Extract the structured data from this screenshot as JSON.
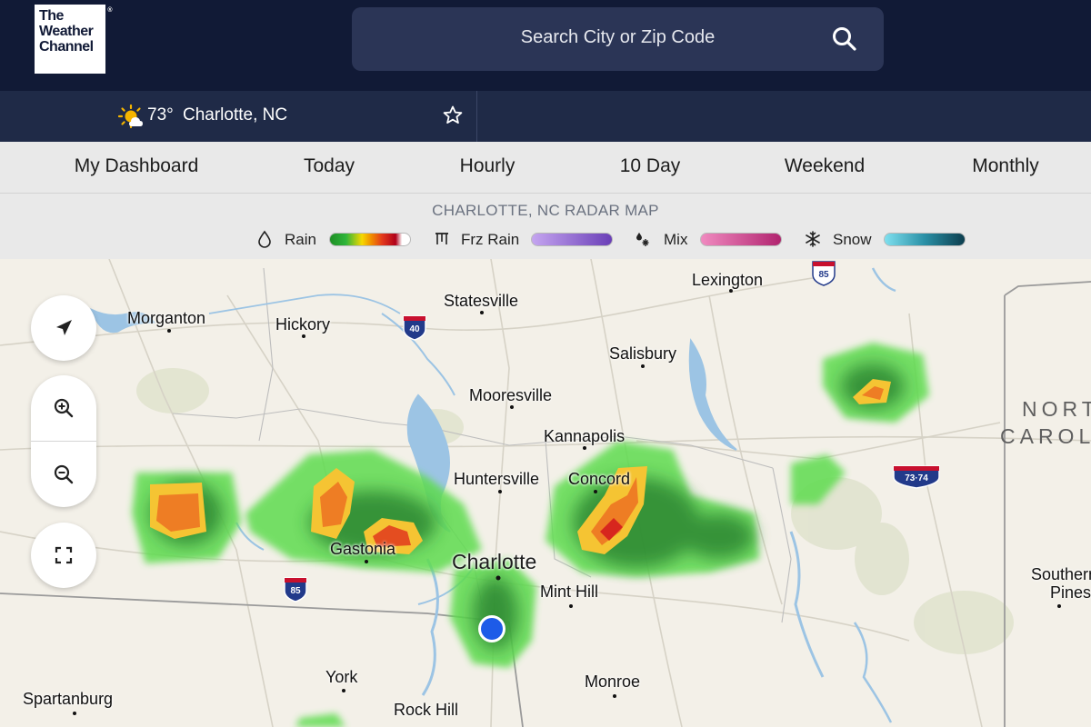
{
  "header": {
    "logo_lines": [
      "The",
      "Weather",
      "Channel"
    ],
    "logo_reg": "®",
    "search": {
      "placeholder": "Search City or Zip Code",
      "icon": "search-icon"
    }
  },
  "location": {
    "temp": "73°",
    "city": "Charlotte, NC",
    "weather_icon": "partly-cloudy-sun-icon",
    "favorite_icon": "star-icon"
  },
  "nav": {
    "items": [
      {
        "label": "My Dashboard"
      },
      {
        "label": "Today"
      },
      {
        "label": "Hourly"
      },
      {
        "label": "10 Day"
      },
      {
        "label": "Weekend"
      },
      {
        "label": "Monthly"
      }
    ]
  },
  "legend": {
    "title": "CHARLOTTE, NC RADAR MAP",
    "items": [
      {
        "label": "Rain",
        "icon": "raindrop-icon",
        "colors": [
          "#1e8f25",
          "#f6d800",
          "#e33a1c",
          "#b0001a",
          "#ffffff"
        ]
      },
      {
        "label": "Frz Rain",
        "icon": "freezing-rain-icon",
        "colors": [
          "#c5a5f0",
          "#6a3fb7"
        ]
      },
      {
        "label": "Mix",
        "icon": "mix-icon",
        "colors": [
          "#f08ac0",
          "#b1246f"
        ]
      },
      {
        "label": "Snow",
        "icon": "snowflake-icon",
        "colors": [
          "#7fe0ef",
          "#0d3e4e"
        ]
      }
    ]
  },
  "map": {
    "cities": [
      "Lexington",
      "Statesville",
      "Morganton",
      "Hickory",
      "Salisbury",
      "Mooresville",
      "Kannapolis",
      "Huntersville",
      "Concord",
      "Gastonia",
      "Charlotte",
      "Mint Hill",
      "York",
      "Monroe",
      "Spartanburg",
      "Rock Hill",
      "Southern Pines"
    ],
    "state_label": [
      "NORT",
      "CAROL"
    ],
    "interstates": [
      "85",
      "40",
      "85",
      "73·74"
    ],
    "controls": [
      "locate-icon",
      "zoom-in-icon",
      "zoom-out-icon",
      "fullscreen-icon"
    ]
  }
}
